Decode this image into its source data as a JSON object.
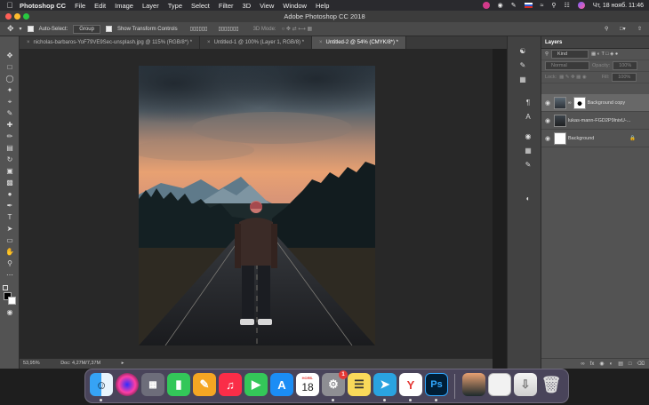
{
  "menubar": {
    "app_name": "Photoshop CC",
    "items": [
      "File",
      "Edit",
      "Image",
      "Layer",
      "Type",
      "Select",
      "Filter",
      "3D",
      "View",
      "Window",
      "Help"
    ],
    "datetime": "Чт, 18 нояб.  11:46"
  },
  "window": {
    "title": "Adobe Photoshop CC 2018"
  },
  "options": {
    "auto_select_label": "Auto-Select:",
    "auto_select_value": "Group",
    "show_transform_label": "Show Transform Controls",
    "mode_3d": "3D Mode:"
  },
  "tabs": [
    {
      "label": "nicholas-barbaros-YoF79VE9Sec-unsplash.jpg @ 115% (RGB/8*) *"
    },
    {
      "label": "Untitled-1 @ 100% (Layer 1, RGB/8) *"
    },
    {
      "label": "Untitled-2 @ 54% (CMYK/8*) *"
    }
  ],
  "status": {
    "zoom": "53,95%",
    "doc": "Doc: 4,27M/7,37M"
  },
  "layers_panel": {
    "title": "Layers",
    "filter_value": "Kind",
    "blend_mode": "Normal",
    "opacity_label": "Opacity:",
    "opacity_value": "100%",
    "lock_label": "Lock:",
    "fill_label": "Fill:",
    "fill_value": "100%",
    "layers": [
      {
        "name": "Background copy",
        "selected": true
      },
      {
        "name": "lukas-mann-FGD2P9lnixU-...",
        "selected": false
      },
      {
        "name": "Background",
        "selected": false,
        "locked": true
      }
    ]
  },
  "dock": {
    "calendar_month": "НОЯБ.",
    "calendar_day": "18",
    "settings_badge": "1",
    "photoshop_label": "Ps"
  },
  "colors": {
    "menubar": "#2a2a2e",
    "toolbar": "#535353",
    "canvas_bg": "#282828",
    "panel": "#535353",
    "selected_layer": "#686868",
    "accent_ps": "#31a8ff"
  }
}
